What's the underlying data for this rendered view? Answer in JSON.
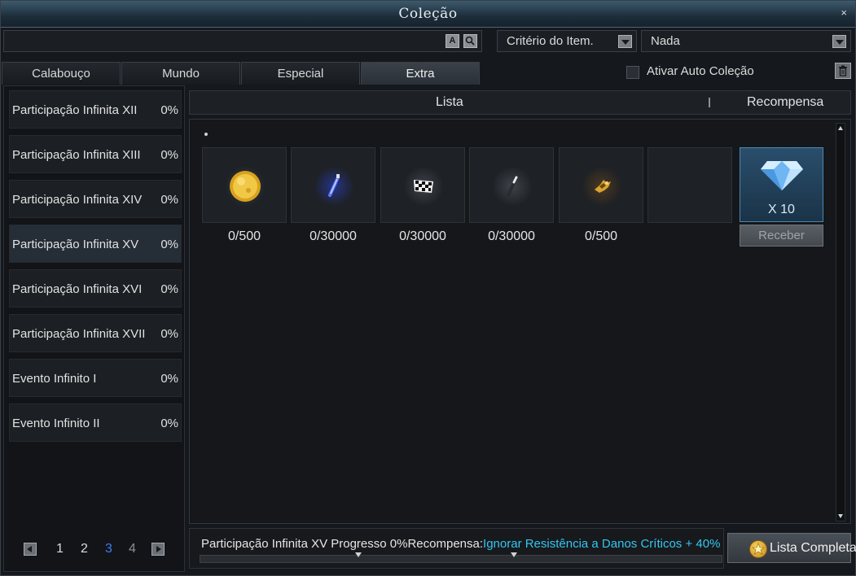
{
  "window": {
    "title": "Coleção",
    "close_label": "×"
  },
  "search": {
    "value": "",
    "btn_a": "A",
    "btn_search": "search-icon",
    "criteria_select": "Critério do Item.",
    "filter_select": "Nada"
  },
  "tabs": [
    {
      "label": "Calabouço",
      "active": false
    },
    {
      "label": "Mundo",
      "active": false
    },
    {
      "label": "Especial",
      "active": false
    },
    {
      "label": "Extra",
      "active": true
    }
  ],
  "auto_collect": {
    "label": "Ativar Auto Coleção",
    "checked": false
  },
  "list": [
    {
      "name": "Participação Infinita XII",
      "percent": "0%"
    },
    {
      "name": "Participação Infinita XIII",
      "percent": "0%"
    },
    {
      "name": "Participação Infinita XIV",
      "percent": "0%"
    },
    {
      "name": "Participação Infinita XV",
      "percent": "0%",
      "selected": true
    },
    {
      "name": "Participação Infinita XVI",
      "percent": "0%"
    },
    {
      "name": "Participação Infinita XVII",
      "percent": "0%"
    },
    {
      "name": "Evento Infinito I",
      "percent": "0%"
    },
    {
      "name": "Evento Infinito II",
      "percent": "0%"
    }
  ],
  "pagination": {
    "pages": [
      "1",
      "2",
      "3",
      "4"
    ],
    "current": "3"
  },
  "columns": {
    "lista": "Lista",
    "recompensa": "Recompensa"
  },
  "items": [
    {
      "icon": "gold-coin-icon",
      "count": "0/500"
    },
    {
      "icon": "blue-potion-icon",
      "count": "0/30000"
    },
    {
      "icon": "checkered-flag-icon",
      "count": "0/30000"
    },
    {
      "icon": "dark-wand-icon",
      "count": "0/30000"
    },
    {
      "icon": "gold-fragment-icon",
      "count": "0/500"
    },
    {
      "icon": "empty-slot",
      "count": ""
    }
  ],
  "reward": {
    "icon": "diamond-icon",
    "quantity": "X 10",
    "button": "Receber"
  },
  "footer": {
    "progress_text": "Participação Infinita XV Progresso 0%",
    "reward_prefix": "Recompensa:",
    "reward_value": "Ignorar Resistência a Danos Críticos + 40%",
    "progress": 0,
    "reward_color": "#34c6f0"
  },
  "full_list_button": {
    "icon": "star-icon",
    "label": "Lista Completa"
  }
}
